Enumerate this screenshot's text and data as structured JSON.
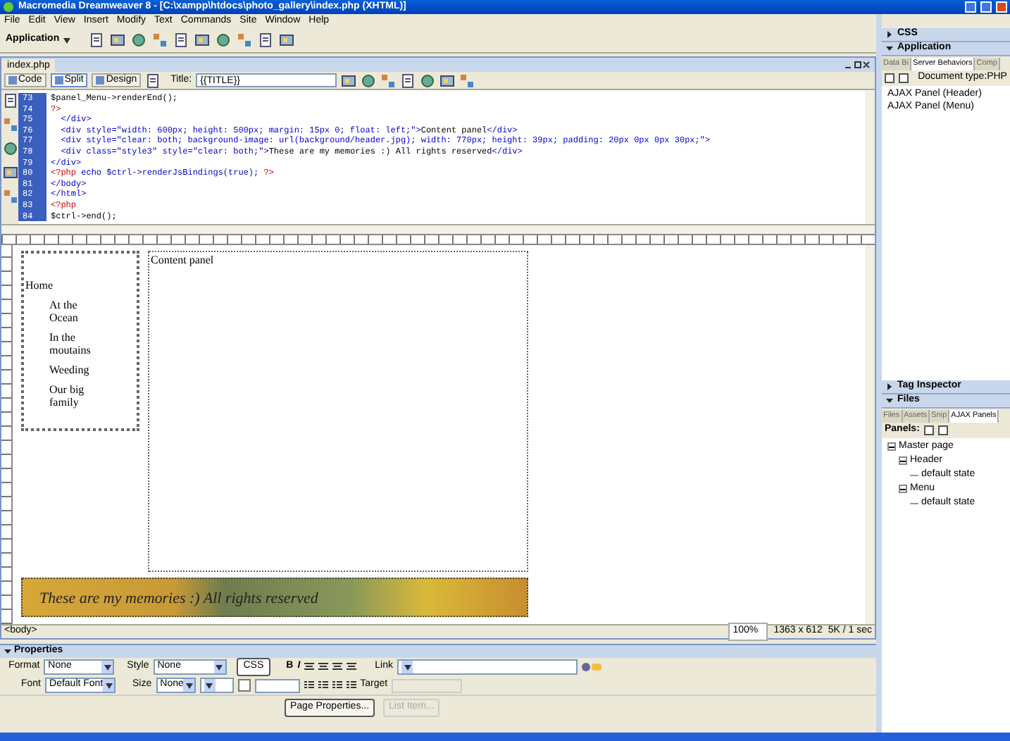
{
  "window": {
    "title": "Macromedia Dreamweaver 8 - [C:\\xampp\\htdocs\\photo_gallery\\index.php (XHTML)]"
  },
  "menu": [
    "File",
    "Edit",
    "View",
    "Insert",
    "Modify",
    "Text",
    "Commands",
    "Site",
    "Window",
    "Help"
  ],
  "insert_bar": {
    "category": "Application"
  },
  "document": {
    "tab": "index.php",
    "views": [
      {
        "label": "Code",
        "selected": false
      },
      {
        "label": "Split",
        "selected": true
      },
      {
        "label": "Design",
        "selected": false
      }
    ],
    "title_label": "Title:",
    "title_value": "{{TITLE}}",
    "code_lines": [
      {
        "number": "73",
        "segments": [
          {
            "kind": "plain",
            "text": "$panel_Menu->renderEnd();"
          }
        ]
      },
      {
        "number": "74",
        "segments": [
          {
            "kind": "php",
            "text": "?>"
          }
        ]
      },
      {
        "number": "75",
        "segments": [
          {
            "kind": "markup",
            "text": "  </div>"
          }
        ]
      },
      {
        "number": "76",
        "segments": [
          {
            "kind": "markup",
            "text": "  <div style=\"width: 600px; height: 500px; margin: 15px 0; float: left;\">"
          },
          {
            "kind": "plain",
            "text": "Content panel"
          },
          {
            "kind": "markup",
            "text": "</div>"
          }
        ]
      },
      {
        "number": "77",
        "segments": [
          {
            "kind": "markup",
            "text": "  <div style=\"clear: both; background-image: url(background/header.jpg); width: 770px; height: 39px; padding: 20px 0px 0px 30px;\">"
          }
        ]
      },
      {
        "number": "78",
        "segments": [
          {
            "kind": "markup",
            "text": "  <div class=\"style3\" style=\"clear: both;\">"
          },
          {
            "kind": "plain",
            "text": "These are my memories :) All rights reserved"
          },
          {
            "kind": "markup",
            "text": "</div>"
          }
        ]
      },
      {
        "number": "79",
        "segments": [
          {
            "kind": "markup",
            "text": "</div>"
          }
        ]
      },
      {
        "number": "80",
        "segments": [
          {
            "kind": "php",
            "text": "<?php"
          },
          {
            "kind": "markup",
            "text": " echo $ctrl->renderJsBindings(true); "
          },
          {
            "kind": "php",
            "text": "?>"
          }
        ]
      },
      {
        "number": "81",
        "segments": [
          {
            "kind": "markup",
            "text": "</body>"
          }
        ]
      },
      {
        "number": "82",
        "segments": [
          {
            "kind": "markup",
            "text": "</html>"
          }
        ]
      },
      {
        "number": "83",
        "segments": [
          {
            "kind": "php",
            "text": "<?php"
          }
        ]
      },
      {
        "number": "84",
        "segments": [
          {
            "kind": "plain",
            "text": "$ctrl->end();"
          }
        ]
      }
    ],
    "design": {
      "menu_items": [
        {
          "label": "Home",
          "children": [
            {
              "label": "At the Ocean"
            },
            {
              "label": "In the moutains"
            },
            {
              "label": "Weeding"
            },
            {
              "label": "Our big family"
            }
          ]
        }
      ],
      "content_panel": "Content panel",
      "footer": "These are my memories :) All rights reserved"
    },
    "status": {
      "tag": "<body>",
      "zoom": "100%",
      "size": "1363 x 612",
      "weight": "5K / 1 sec"
    }
  },
  "properties": {
    "title": "Properties",
    "format_label": "Format",
    "format": "None",
    "style_label": "Style",
    "style": "None",
    "css": "CSS",
    "bold": "B",
    "italic": "I",
    "link_label": "Link",
    "font_label": "Font",
    "font": "Default Font",
    "size_label": "Size",
    "size": "None",
    "target_label": "Target",
    "page_properties": "Page Properties...",
    "list_item": "List Item..."
  },
  "panels": [
    {
      "title": "CSS",
      "expanded": false
    },
    {
      "title": "Application",
      "expanded": true,
      "tabs": [
        {
          "label": "Data Bi",
          "selected": false
        },
        {
          "label": "Server Behaviors",
          "selected": true
        },
        {
          "label": "Comp",
          "selected": false
        }
      ],
      "toolbar_text": "Document type:PHP",
      "items": [
        "AJAX Panel (Header)",
        "AJAX Panel (Menu)"
      ]
    },
    {
      "title": "Tag Inspector",
      "expanded": false
    },
    {
      "title": "Files",
      "expanded": true,
      "tabs": [
        {
          "label": "Files",
          "selected": false
        },
        {
          "label": "Assets",
          "selected": false
        },
        {
          "label": "Snip",
          "selected": false
        },
        {
          "label": "AJAX Panels",
          "selected": true
        }
      ],
      "toolbar_text": "Panels:",
      "tree": [
        {
          "label": "Master page",
          "expanded": true,
          "children": [
            {
              "label": "Header",
              "expanded": true,
              "children": [
                {
                  "label": "default state"
                }
              ]
            },
            {
              "label": "Menu",
              "expanded": true,
              "children": [
                {
                  "label": "default state"
                }
              ]
            }
          ]
        }
      ]
    }
  ]
}
